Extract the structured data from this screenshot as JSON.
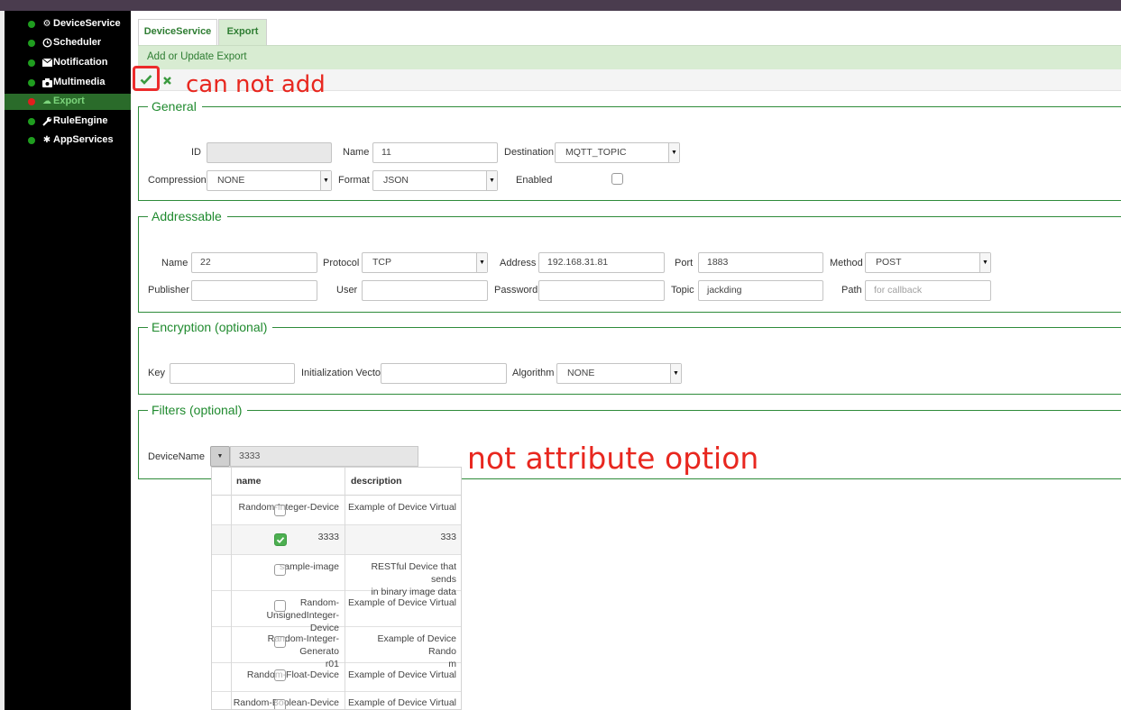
{
  "sidebar": {
    "items": [
      {
        "label": "DeviceService",
        "icon": "gears-icon",
        "status": "green"
      },
      {
        "label": "Scheduler",
        "icon": "clock-icon",
        "status": "green"
      },
      {
        "label": "Notification",
        "icon": "envelope-icon",
        "status": "green"
      },
      {
        "label": "Multimedia",
        "icon": "camera-icon",
        "status": "green"
      },
      {
        "label": "Export",
        "icon": "cloud-upload-icon",
        "status": "red",
        "active": true
      },
      {
        "label": "RuleEngine",
        "icon": "wrench-icon",
        "status": "green"
      },
      {
        "label": "AppServices",
        "icon": "asterisk-icon",
        "status": "green"
      }
    ]
  },
  "tabs": [
    {
      "label": "DeviceService",
      "active": false
    },
    {
      "label": "Export",
      "active": true
    }
  ],
  "subheader": "Add or Update Export",
  "annotations": {
    "add": "can not add",
    "filter": "not attribute option"
  },
  "general": {
    "legend": "General",
    "id_label": "ID",
    "id_value": "",
    "name_label": "Name",
    "name_value": "11",
    "destination_label": "Destination",
    "destination_value": "MQTT_TOPIC",
    "compression_label": "Compression",
    "compression_value": "NONE",
    "format_label": "Format",
    "format_value": "JSON",
    "enabled_label": "Enabled",
    "enabled": false
  },
  "addressable": {
    "legend": "Addressable",
    "name_label": "Name",
    "name_value": "22",
    "protocol_label": "Protocol",
    "protocol_value": "TCP",
    "address_label": "Address",
    "address_value": "192.168.31.81",
    "port_label": "Port",
    "port_value": "1883",
    "method_label": "Method",
    "method_value": "POST",
    "publisher_label": "Publisher",
    "publisher_value": "",
    "user_label": "User",
    "user_value": "",
    "password_label": "Password",
    "password_value": "",
    "topic_label": "Topic",
    "topic_value": "jackding",
    "path_label": "Path",
    "path_placeholder": "for callback"
  },
  "encryption": {
    "legend": "Encryption (optional)",
    "key_label": "Key",
    "key_value": "",
    "iv_label": "Initialization Vector",
    "iv_value": "",
    "algorithm_label": "Algorithm",
    "algorithm_value": "NONE"
  },
  "filters": {
    "legend": "Filters (optional)",
    "device_name_label": "DeviceName",
    "device_name_value": "3333",
    "grid": {
      "columns": [
        "name",
        "description"
      ],
      "rows": [
        {
          "name": [
            "Random-Integer-Device"
          ],
          "description": [
            "Example of Device Virtual"
          ],
          "checked": false
        },
        {
          "name": [
            "3333"
          ],
          "description": [
            "333"
          ],
          "checked": true
        },
        {
          "name": [
            "sample-image"
          ],
          "description": [
            "RESTful Device that sends",
            "in binary image data"
          ],
          "checked": false
        },
        {
          "name": [
            "Random-UnsignedInteger-",
            "Device"
          ],
          "description": [
            "Example of Device Virtual"
          ],
          "checked": false
        },
        {
          "name": [
            "Random-Integer-Generato",
            "r01"
          ],
          "description": [
            "Example of Device Rando",
            "m"
          ],
          "checked": false
        },
        {
          "name": [
            "Random-Float-Device"
          ],
          "description": [
            "Example of Device Virtual"
          ],
          "checked": false
        },
        {
          "name": [
            "Random-Boolean-Device"
          ],
          "description": [
            "Example of Device Virtual"
          ],
          "checked": false
        }
      ]
    }
  },
  "colors": {
    "accent_green": "#2e7d32",
    "status_green": "#1f9d1f",
    "status_red": "#e21d1d",
    "annotation_red": "#e8271f"
  }
}
